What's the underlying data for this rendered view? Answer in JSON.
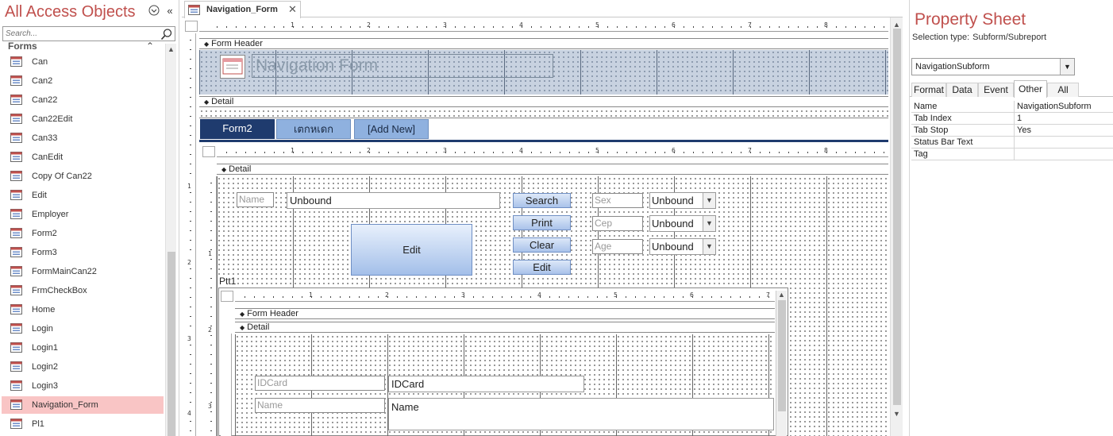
{
  "nav_pane": {
    "title": "All Access Objects",
    "search_placeholder": "Search...",
    "group_label": "Forms",
    "items": [
      {
        "label": "Can"
      },
      {
        "label": "Can2"
      },
      {
        "label": "Can22"
      },
      {
        "label": "Can22Edit"
      },
      {
        "label": "Can33"
      },
      {
        "label": "CanEdit"
      },
      {
        "label": "Copy Of Can22"
      },
      {
        "label": "Edit"
      },
      {
        "label": "Employer"
      },
      {
        "label": "Form2"
      },
      {
        "label": "Form3"
      },
      {
        "label": "FormMainCan22"
      },
      {
        "label": "FrmCheckBox"
      },
      {
        "label": "Home"
      },
      {
        "label": "Login"
      },
      {
        "label": "Login1"
      },
      {
        "label": "Login2"
      },
      {
        "label": "Login3"
      },
      {
        "label": "Navigation_Form",
        "selected": true
      },
      {
        "label": "Pl1"
      }
    ]
  },
  "document": {
    "tab_label": "Navigation_Form",
    "ruler_top": [
      "1",
      "2",
      "3",
      "4",
      "5",
      "6",
      "7",
      "8"
    ],
    "ruler_sub": [
      "1",
      "2",
      "3",
      "4",
      "5",
      "6",
      "7",
      "8"
    ],
    "ruler_inner": [
      "1",
      "2",
      "3",
      "4",
      "5",
      "6",
      "7"
    ],
    "vruler_labels": [
      "1",
      "1",
      "2",
      "1",
      "2",
      "3",
      "3",
      "4"
    ],
    "form_header_label": "Form Header",
    "detail_label": "Detail",
    "header_title": "Navigation Form",
    "nav_buttons": [
      "Form2",
      "เตกหเดก",
      "[Add New]"
    ],
    "subform_detail_label": "Detail",
    "name_label": "Name",
    "name_value": "Unbound",
    "buttons": {
      "search": "Search",
      "print": "Print",
      "clear": "Clear",
      "edit": "Edit",
      "edit_big": "Edit"
    },
    "sex_label": "Sex",
    "sex_value": "Unbound",
    "cep_label": "Cep",
    "cep_value": "Unbound",
    "age_label": "Age",
    "age_value": "Unbound",
    "subform_name": "Ptt1",
    "inner_form_header_label": "Form Header",
    "inner_detail_label": "Detail",
    "idcard_label": "IDCard",
    "idcard_value": "IDCard",
    "inner_name_label": "Name",
    "inner_name_value": "Name"
  },
  "property_sheet": {
    "title": "Property Sheet",
    "selection_type_label": "Selection type:",
    "selection_type_value": "Subform/Subreport",
    "object_selected": "NavigationSubform",
    "tabs": [
      "Format",
      "Data",
      "Event",
      "Other",
      "All"
    ],
    "active_tab": "Other",
    "rows": [
      {
        "key": "Name",
        "value": "NavigationSubform"
      },
      {
        "key": "Tab Index",
        "value": "1"
      },
      {
        "key": "Tab Stop",
        "value": "Yes"
      },
      {
        "key": "Status Bar Text",
        "value": ""
      },
      {
        "key": "Tag",
        "value": ""
      }
    ]
  },
  "colors": {
    "accent_title": "#c0504d",
    "nav_button_active": "#1f3b6e",
    "nav_button_inactive": "#8fb1df",
    "selected_item": "#f9c5c5"
  }
}
